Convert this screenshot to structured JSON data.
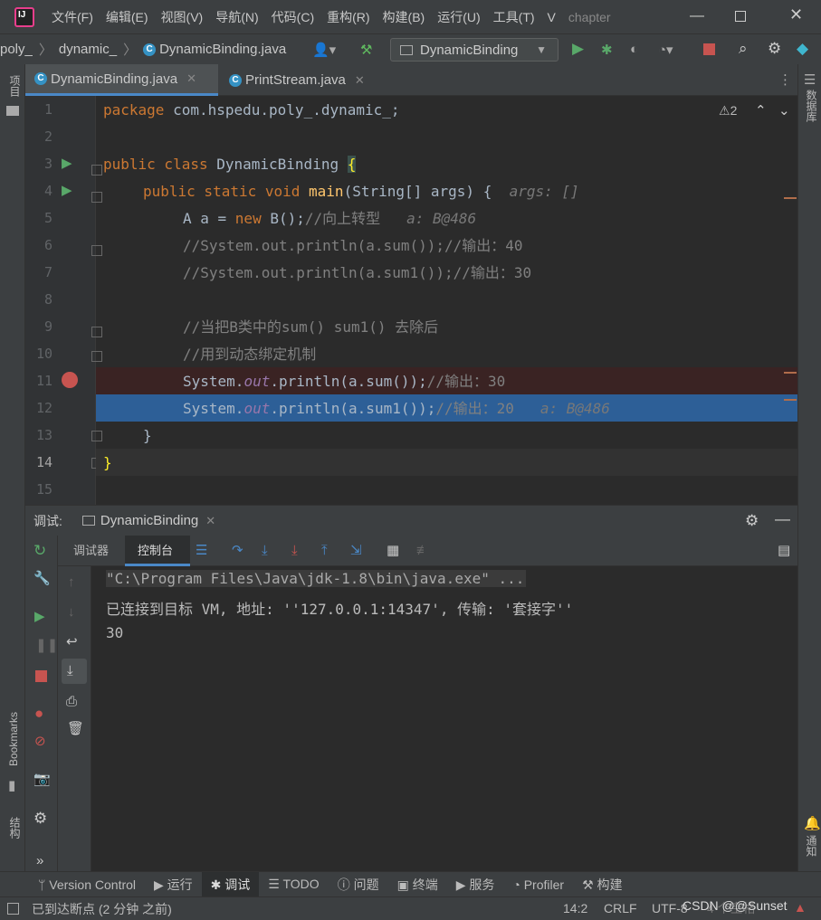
{
  "menu": [
    "文件(F)",
    "编辑(E)",
    "视图(V)",
    "导航(N)",
    "代码(C)",
    "重构(R)",
    "构建(B)",
    "运行(U)",
    "工具(T)",
    "V"
  ],
  "window_title": "chapter",
  "breadcrumbs": [
    "poly_",
    "dynamic_",
    "DynamicBinding.java"
  ],
  "run_config": "DynamicBinding",
  "left_strip": {
    "project": "项目",
    "bookmarks": "Bookmarks",
    "structure": "结构"
  },
  "right_strip": {
    "database": "数据库",
    "notifications": "通知"
  },
  "tabs": [
    {
      "label": "DynamicBinding.java",
      "active": true
    },
    {
      "label": "PrintStream.java",
      "active": false
    }
  ],
  "editor": {
    "warnings": "2",
    "line_numbers": [
      "1",
      "2",
      "3",
      "4",
      "5",
      "6",
      "7",
      "8",
      "9",
      "10",
      "11",
      "12",
      "13",
      "14",
      "15"
    ],
    "lines": {
      "l1_kw": "package",
      "l1_rest": " com.hspedu.poly_.dynamic_;",
      "l3_kw": "public class",
      "l3_name": " DynamicBinding ",
      "l3_brace": "{",
      "l4_kw": "public static void",
      "l4_fn": " main",
      "l4_rest": "(String[] args) {",
      "l4_hint": "args: []",
      "l5_code": "A a = ",
      "l5_kw": "new",
      "l5_rest": " B();",
      "l5_cm": "//向上转型",
      "l5_hint": "a: B@486",
      "l6": "//System.out.println(a.sum());//输出：40",
      "l7": "//System.out.println(a.sum1());//输出：30",
      "l9": "//当把B类中的sum() sum1() 去除后",
      "l10": "//用到动态绑定机制",
      "l11_a": "System.",
      "l11_out": "out",
      "l11_b": ".println(a.sum());",
      "l11_cm": "//输出：30",
      "l12_a": "System.",
      "l12_out": "out",
      "l12_b": ".println(a.sum1());",
      "l12_cm": "//输出：20",
      "l12_hint": "a: B@486",
      "l13": "}",
      "l14": "}"
    }
  },
  "debug": {
    "label": "调试:",
    "session": "DynamicBinding",
    "tab_debugger": "调试器",
    "tab_console": "控制台",
    "console_lines": [
      "\"C:\\Program Files\\Java\\jdk-1.8\\bin\\java.exe\" ...",
      "已连接到目标 VM, 地址: ''127.0.0.1:14347', 传输: '套接字''",
      "30"
    ]
  },
  "toolwindows": [
    "Version Control",
    "运行",
    "调试",
    "TODO",
    "问题",
    "终端",
    "服务",
    "Profiler",
    "构建"
  ],
  "status": {
    "message": "已到达断点 (2 分钟 之前)",
    "position": "14:2",
    "line_sep": "CRLF",
    "encoding": "UTF-8",
    "indent": "4 个空格",
    "watermark": "CSDN @@Sunset"
  }
}
